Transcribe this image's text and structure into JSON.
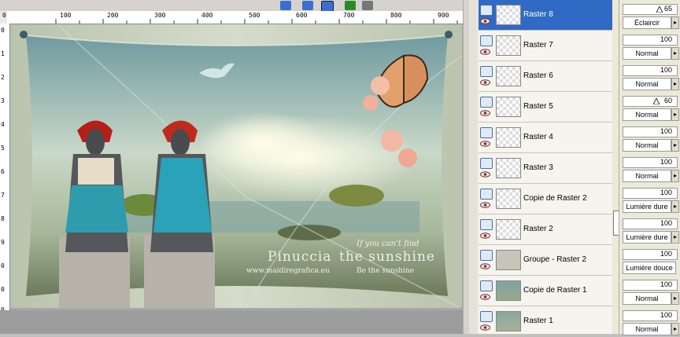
{
  "ruler": {
    "top_labels": [
      "0",
      "100",
      "200",
      "300",
      "400",
      "500",
      "600",
      "700",
      "800",
      "900"
    ],
    "left_labels": [
      "0",
      "1",
      "2",
      "3",
      "4",
      "5",
      "6",
      "7",
      "8",
      "9",
      "0",
      "0",
      "0"
    ]
  },
  "artwork": {
    "signature_name": "Pinuccia",
    "website": "www.maidiregrafica.eu",
    "quote_line1": "If you can't find",
    "quote_line2": "the sunshine",
    "quote_line3": "Be the sunshine"
  },
  "layers": [
    {
      "name": "Raster 8",
      "selected": true
    },
    {
      "name": "Raster 7"
    },
    {
      "name": "Raster 6"
    },
    {
      "name": "Raster 5"
    },
    {
      "name": "Raster 4"
    },
    {
      "name": "Raster 3"
    },
    {
      "name": "Copie de Raster 2"
    },
    {
      "name": "Raster 2"
    },
    {
      "name": "Groupe - Raster 2"
    },
    {
      "name": "Copie de Raster 1"
    },
    {
      "name": "Raster 1"
    }
  ],
  "layer_props": [
    {
      "opacity": "65",
      "blend": "Éclaircir"
    },
    {
      "opacity": "100",
      "blend": "Normal"
    },
    {
      "opacity": "100",
      "blend": "Normal"
    },
    {
      "opacity": "60",
      "blend": "Normal"
    },
    {
      "opacity": "100",
      "blend": "Normal"
    },
    {
      "opacity": "100",
      "blend": "Normal"
    },
    {
      "opacity": "100",
      "blend": "Lumière dure"
    },
    {
      "opacity": "100",
      "blend": "Lumière dure"
    },
    {
      "opacity": "100",
      "blend": "Lumière douce"
    },
    {
      "opacity": "100",
      "blend": "Normal"
    },
    {
      "opacity": "100",
      "blend": "Normal"
    }
  ],
  "icons": {
    "eye": "eye-icon",
    "layer_type": "raster-layer-icon",
    "dropdown": "chevron-right-icon"
  },
  "colors": {
    "selection": "#316ac5",
    "panel": "#ece9d8"
  }
}
